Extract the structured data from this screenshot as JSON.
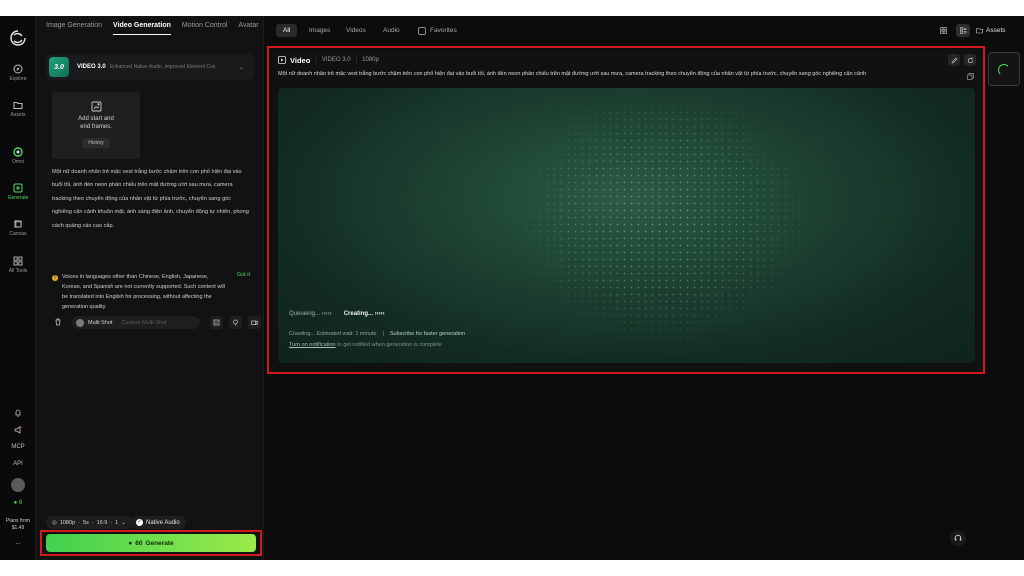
{
  "colors": {
    "accent": "#4cd964",
    "generate_gradient_start": "#3fd14f",
    "generate_gradient_end": "#9bea4a",
    "highlight_box": "#d11a1f"
  },
  "rail": {
    "items": [
      {
        "label": "Explore",
        "icon": "compass-icon"
      },
      {
        "label": "Assets",
        "icon": "folder-icon"
      },
      {
        "label": "Omni",
        "icon": "omni-icon"
      },
      {
        "label": "Generate",
        "icon": "generate-icon"
      },
      {
        "label": "Canvas",
        "icon": "canvas-icon"
      },
      {
        "label": "All Tools",
        "icon": "grid-icon"
      }
    ],
    "mcp_label": "MCP",
    "api_label": "API",
    "credits": "6",
    "plans_label": "Plans from",
    "plans_price": "$1.49",
    "more_label": "..."
  },
  "panel": {
    "tabs": [
      "Image Generation",
      "Video Generation",
      "Motion Control",
      "Avatar"
    ],
    "active_tab": "Video Generation",
    "model": {
      "badge": "3.0",
      "name": "VIDEO 3.0",
      "description": "Enhanced Native Audio, Improved Element Con"
    },
    "frames": {
      "label_line1": "Add start and",
      "label_line2": "end frames.",
      "history": "History"
    },
    "prompt": "Một nữ doanh nhân trẻ mặc vest trắng bước chậm trên con phố hiện đại vào buổi tối, ánh đèn neon phản chiếu trên mặt đường ướt sau mưa, camera tracking theo chuyển động của nhân vật từ phía trước, chuyển sang góc nghiêng cận cảnh khuôn mặt, ánh sáng điện ảnh, chuyển động tự nhiên, phong cách quảng cáo cao cấp.",
    "notice": {
      "text": "Voices in languages other than Chinese, English, Japanese, Korean, and Spanish are not currently supported. Such content will be translated into English for processing, without affecting the generation quality.",
      "dismiss": "Got it"
    },
    "multishot": {
      "label": "Multi Shot",
      "placeholder": "Custom Multi-Shot"
    },
    "settings": {
      "resolution": "1080p",
      "duration": "5s",
      "ratio": "16:9",
      "count": "1"
    },
    "native_audio": "Native Audio",
    "generate": {
      "cost": "60",
      "label": "Generate"
    }
  },
  "topbar": {
    "filters": [
      "All",
      "Images",
      "Videos",
      "Audio"
    ],
    "active_filter": "All",
    "favorites": "Favorites",
    "assets": "Assets"
  },
  "card": {
    "title": "Video",
    "model": "VIDEO 3.0",
    "resolution": "1080p",
    "prompt": "Một nữ doanh nhân trẻ mặc vest trắng bước chậm trên con phố hiện đại vào buổi tối, ánh đèn neon phản chiếu trên mặt đường ướt sau mưa, camera tracking theo chuyển động của nhân vật từ phía trước, chuyển sang góc nghiêng cận cảnh",
    "status_queue": "Queueing... ›››››",
    "status_creating": "Creating... ›››››",
    "wait_label": "Crawling... Estimated wait: 1 minute",
    "subscribe_label": "Subscribe for faster generation",
    "notify_link": "Turn on notification",
    "notify_rest": "to get notified when generation is complete"
  }
}
